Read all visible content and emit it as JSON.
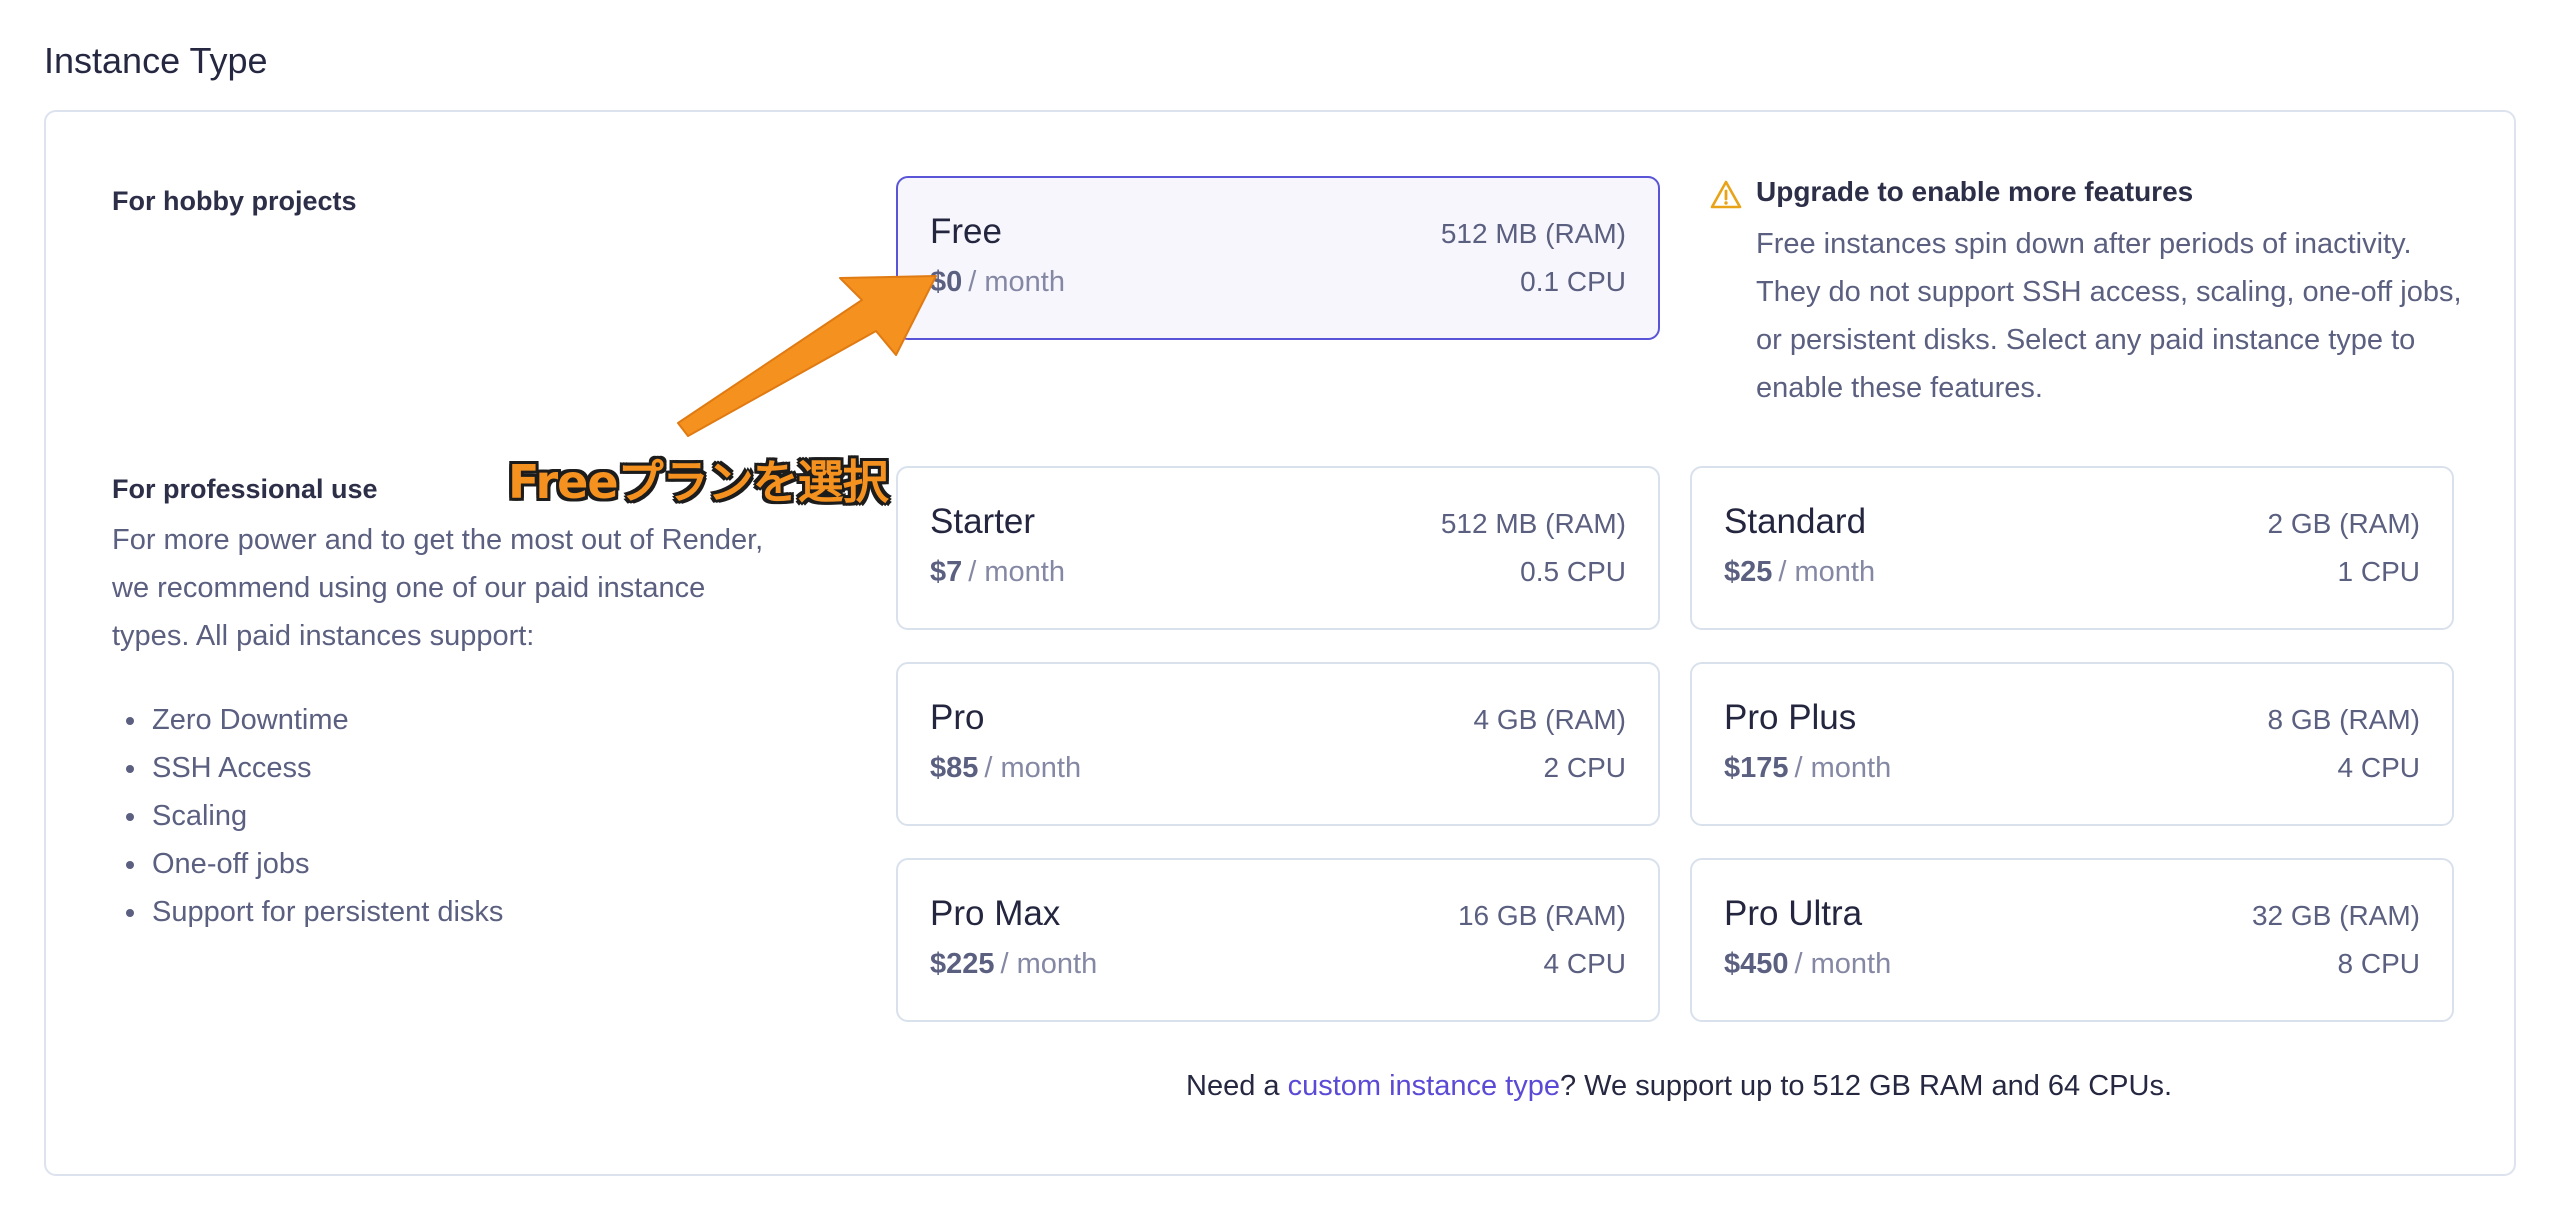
{
  "page": {
    "title": "Instance Type"
  },
  "hobby": {
    "heading": "For hobby projects"
  },
  "professional": {
    "heading": "For professional use",
    "description": "For more power and to get the most out of Render, we recommend using one of our paid instance types. All paid instances support:",
    "features": [
      "Zero Downtime",
      "SSH Access",
      "Scaling",
      "One-off jobs",
      "Support for persistent disks"
    ]
  },
  "plans": [
    {
      "name": "Free",
      "price": "$0",
      "period": "/ month",
      "ram": "512 MB (RAM)",
      "cpu": "0.1 CPU",
      "selected": true
    },
    {
      "name": "Starter",
      "price": "$7",
      "period": "/ month",
      "ram": "512 MB (RAM)",
      "cpu": "0.5 CPU"
    },
    {
      "name": "Standard",
      "price": "$25",
      "period": "/ month",
      "ram": "2 GB (RAM)",
      "cpu": "1 CPU"
    },
    {
      "name": "Pro",
      "price": "$85",
      "period": "/ month",
      "ram": "4 GB (RAM)",
      "cpu": "2 CPU"
    },
    {
      "name": "Pro Plus",
      "price": "$175",
      "period": "/ month",
      "ram": "8 GB (RAM)",
      "cpu": "4 CPU"
    },
    {
      "name": "Pro Max",
      "price": "$225",
      "period": "/ month",
      "ram": "16 GB (RAM)",
      "cpu": "4 CPU"
    },
    {
      "name": "Pro Ultra",
      "price": "$450",
      "period": "/ month",
      "ram": "32 GB (RAM)",
      "cpu": "8 CPU"
    }
  ],
  "notice": {
    "icon": "warning-triangle-icon",
    "title": "Upgrade to enable more features",
    "body": "Free instances spin down after periods of inactivity. They do not support SSH access, scaling, one-off jobs, or persistent disks. Select any paid instance type to enable these features."
  },
  "custom": {
    "prefix": "Need a ",
    "link": "custom instance type",
    "suffix": "? We support up to 512 GB RAM and 64 CPUs."
  },
  "annotation": {
    "label": "Freeプランを選択",
    "color": "#f5921f"
  },
  "colors": {
    "selected_border": "#5a55d6",
    "link": "#5a4ad6",
    "warning": "#e8a317"
  }
}
